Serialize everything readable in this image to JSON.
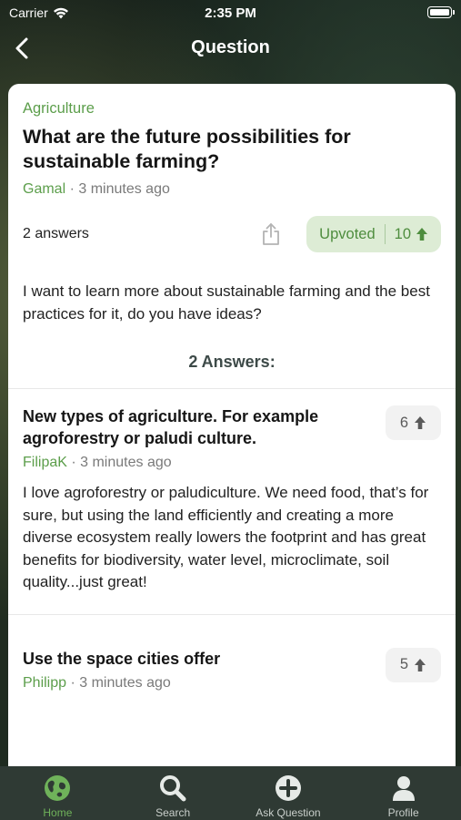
{
  "status_bar": {
    "carrier": "Carrier",
    "time": "2:35 PM"
  },
  "nav": {
    "title": "Question"
  },
  "question": {
    "category": "Agriculture",
    "title": "What are the future possibilities for sustainable farming?",
    "author": "Gamal",
    "time": "· 3 minutes ago",
    "answer_count": "2 answers",
    "upvote_label": "Upvoted",
    "upvote_count": "10",
    "body": "I want to learn more about sustainable farming and the best practices for it, do you have ideas?"
  },
  "answers_heading": "2 Answers:",
  "answers": [
    {
      "title": "New types of agriculture. For example agroforestry or paludi culture.",
      "author": "FilipaK",
      "time": "· 3 minutes ago",
      "votes": "6",
      "body": "I love agroforestry or paludiculture. We need food, that’s for sure, but using the land efficiently and creating a more diverse ecosystem really lowers the footprint and has great benefits for biodiversity, water level, microclimate, soil quality...just great!"
    },
    {
      "title": "Use the space cities offer",
      "author": "Philipp",
      "time": "· 3 minutes ago",
      "votes": "5"
    }
  ],
  "tabs": [
    {
      "label": "Home",
      "icon": "globe-icon",
      "active": true
    },
    {
      "label": "Search",
      "icon": "search-icon"
    },
    {
      "label": "Ask Question",
      "icon": "plus-circle-icon"
    },
    {
      "label": "Profile",
      "icon": "person-icon"
    }
  ],
  "colors": {
    "accent_green": "#5c9e4b",
    "upvote_bg": "#ddecd5",
    "tab_bar_bg": "#2f3a34",
    "tab_active": "#6fb25a"
  }
}
